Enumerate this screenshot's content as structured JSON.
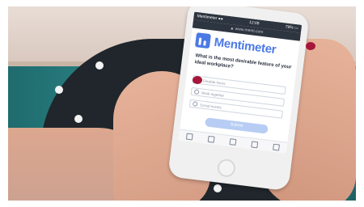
{
  "scene": {
    "colors": {
      "background": "#2a7d7f",
      "skirt": "#20262b",
      "nail_polish": "#a5163a",
      "brand": "#4b79e6"
    }
  },
  "phone": {
    "status_left": "Mentimeter ●●",
    "status_time": "12:09",
    "status_right": "79% ▭",
    "url": "▲ www.menti.com",
    "brand_name": "Mentimeter",
    "question": "What is the most desirable feature of your ideal workplace?",
    "options": [
      "Flexible hours",
      "Work together",
      "Social events"
    ],
    "submit_label": "Submit",
    "toolbar_icons": [
      "back-icon",
      "forward-icon",
      "share-icon",
      "bookmarks-icon",
      "tabs-icon"
    ]
  }
}
